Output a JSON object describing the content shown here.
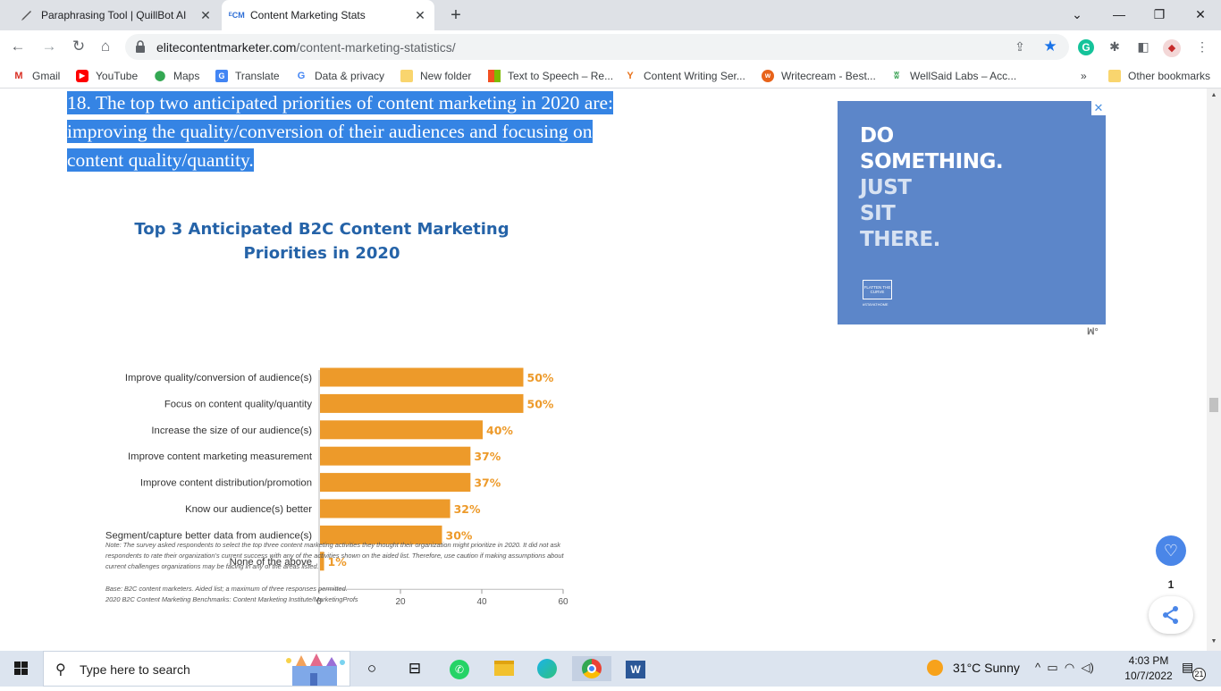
{
  "browser": {
    "tabs": [
      {
        "title": "Paraphrasing Tool | QuillBot AI",
        "icon": "quillbot-icon",
        "active": false
      },
      {
        "title": "Content Marketing Stats",
        "icon": "ecm-icon",
        "active": true
      }
    ],
    "url_domain": "elitecontentmarketer.com",
    "url_path": "/content-marketing-statistics/",
    "bookmarks": [
      "Gmail",
      "YouTube",
      "Maps",
      "Translate",
      "Data & privacy",
      "New folder",
      "Text to Speech – Re...",
      "Content Writing Ser...",
      "Writecream - Best...",
      "WellSaid Labs – Acc..."
    ],
    "bookmarks_overflow": "»",
    "other_bookmarks": "Other bookmarks",
    "extension_badge": "G"
  },
  "article": {
    "heading_lines": [
      "18. The top two anticipated priorities of content marketing in 2020 are:",
      "improving the quality/conversion of their audiences and focusing on",
      "content quality/quantity."
    ]
  },
  "chart_data": {
    "type": "bar",
    "orientation": "horizontal",
    "title": "Top 3 Anticipated B2C Content Marketing Priorities in 2020",
    "title_lines": [
      "Top 3 Anticipated B2C Content Marketing",
      "Priorities in 2020"
    ],
    "categories": [
      "Improve quality/conversion of audience(s)",
      "Focus on content quality/quantity",
      "Increase the size of our audience(s)",
      "Improve content marketing measurement",
      "Improve content distribution/promotion",
      "Know our audience(s) better",
      "Segment/capture better data from audience(s)",
      "None of the above"
    ],
    "values": [
      50,
      50,
      40,
      37,
      37,
      32,
      30,
      1
    ],
    "data_labels": [
      "50%",
      "50%",
      "40%",
      "37%",
      "37%",
      "32%",
      "30%",
      "1%"
    ],
    "x_ticks": [
      0,
      20,
      40,
      60
    ],
    "xlim": [
      0,
      60
    ],
    "bar_color": "#ed9a2a",
    "label_color": "#ed9a2a",
    "title_color": "#2563a8",
    "note": "Note: The survey asked respondents to select the top three content marketing activities they thought their organization might prioritize in 2020. It did not ask respondents to rate their organization’s current success with any of the activities shown on the aided list. Therefore, use caution if making assumptions about current challenges organizations may be facing in any of the areas listed.",
    "base": "Base: B2C content marketers. Aided list; a maximum of three responses permitted.",
    "source": "2020 B2C Content Marketing Benchmarks: Content Marketing Institute/MarketingProfs"
  },
  "ad": {
    "lines": [
      "DO",
      "SOMETHING.",
      "JUST",
      "SIT",
      "THERE."
    ],
    "logo_text": "FLATTEN THE CURVE",
    "tag": "#STAYATHOME",
    "close": "✕",
    "bg_color": "#5c86c9"
  },
  "floating": {
    "share_count": "1"
  },
  "taskbar": {
    "search_placeholder": "Type here to search",
    "weather": "31°C  Sunny",
    "time": "4:03 PM",
    "date": "10/7/2022",
    "notifications": "21"
  }
}
